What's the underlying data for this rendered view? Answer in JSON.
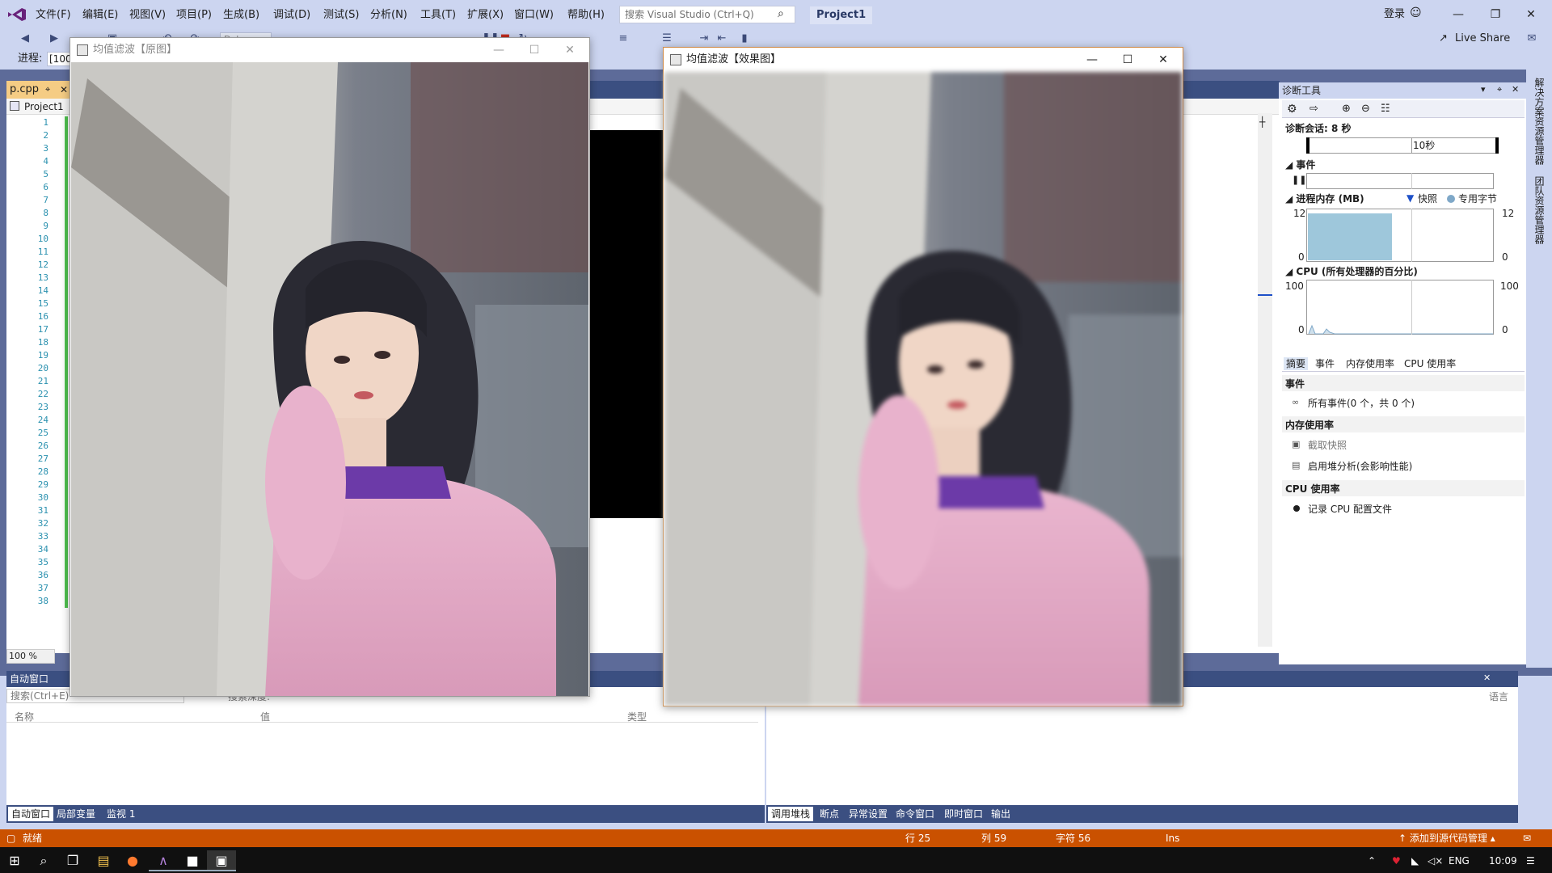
{
  "menu": {
    "items": [
      "文件(F)",
      "编辑(E)",
      "视图(V)",
      "项目(P)",
      "生成(B)",
      "调试(D)",
      "测试(S)",
      "分析(N)",
      "工具(T)",
      "扩展(X)",
      "窗口(W)",
      "帮助(H)"
    ],
    "search_placeholder": "搜索 Visual Studio (Ctrl+Q)",
    "project_title": "Project1",
    "login_label": "登录",
    "live_share_label": "Live Share"
  },
  "toolbar": {
    "config_debug": "Debug",
    "process_label": "进程:",
    "process_value": "[100"
  },
  "editor": {
    "tab_label": "p.cpp",
    "project_label": "Project1",
    "line_numbers": [
      "1",
      "2",
      "3",
      "4",
      "5",
      "6",
      "7",
      "8",
      "9",
      "10",
      "11",
      "12",
      "13",
      "14",
      "15",
      "16",
      "17",
      "18",
      "19",
      "20",
      "21",
      "22",
      "23",
      "24",
      "25",
      "26",
      "27",
      "28",
      "29",
      "30",
      "31",
      "32",
      "33",
      "34",
      "35",
      "36",
      "37",
      "38"
    ],
    "zoom_label": "100 %"
  },
  "windows": {
    "original": {
      "title": "均值滤波【原图】"
    },
    "effect": {
      "title": "均值滤波【效果图】"
    }
  },
  "bottom_left": {
    "title": "自动窗口",
    "search_placeholder": "搜索(Ctrl+E)",
    "search_depth": "搜索深度:",
    "col_name": "名称",
    "col_value": "值",
    "col_type": "类型",
    "tabs": [
      "自动窗口",
      "局部变量",
      "监视 1"
    ]
  },
  "bottom_right": {
    "lang_label": "语言",
    "tabs": [
      "调用堆栈",
      "断点",
      "异常设置",
      "命令窗口",
      "即时窗口",
      "输出"
    ]
  },
  "diagnostics": {
    "title": "诊断工具",
    "session": "诊断会话: 8 秒",
    "timeline_label": "10秒",
    "events_section": "事件",
    "memory_section": "进程内存 (MB)",
    "legend_snapshot": "快照",
    "legend_private": "专用字节",
    "memory_max": "12",
    "memory_min": "0",
    "cpu_section": "CPU (所有处理器的百分比)",
    "cpu_max": "100",
    "cpu_min": "0",
    "tabs": [
      "摘要",
      "事件",
      "内存使用率",
      "CPU 使用率"
    ],
    "events_header": "事件",
    "events_all": "所有事件(0 个，共 0 个)",
    "memory_header": "内存使用率",
    "take_snapshot": "截取快照",
    "heap_analysis": "启用堆分析(会影响性能)",
    "cpu_header": "CPU 使用率",
    "record_cpu": "记录 CPU 配置文件",
    "accent": "#4e9ac2"
  },
  "right_strip": {
    "solution_explorer": "解决方案资源管理器",
    "team_explorer": "团队资源管理器"
  },
  "status": {
    "ready": "就绪",
    "line": "行 25",
    "col": "列 59",
    "char": "字符 56",
    "ins": "Ins",
    "source_control": "添加到源代码管理",
    "bar_color": "#ca5100"
  },
  "taskbar": {
    "lang": "ENG",
    "time": "10:09"
  }
}
